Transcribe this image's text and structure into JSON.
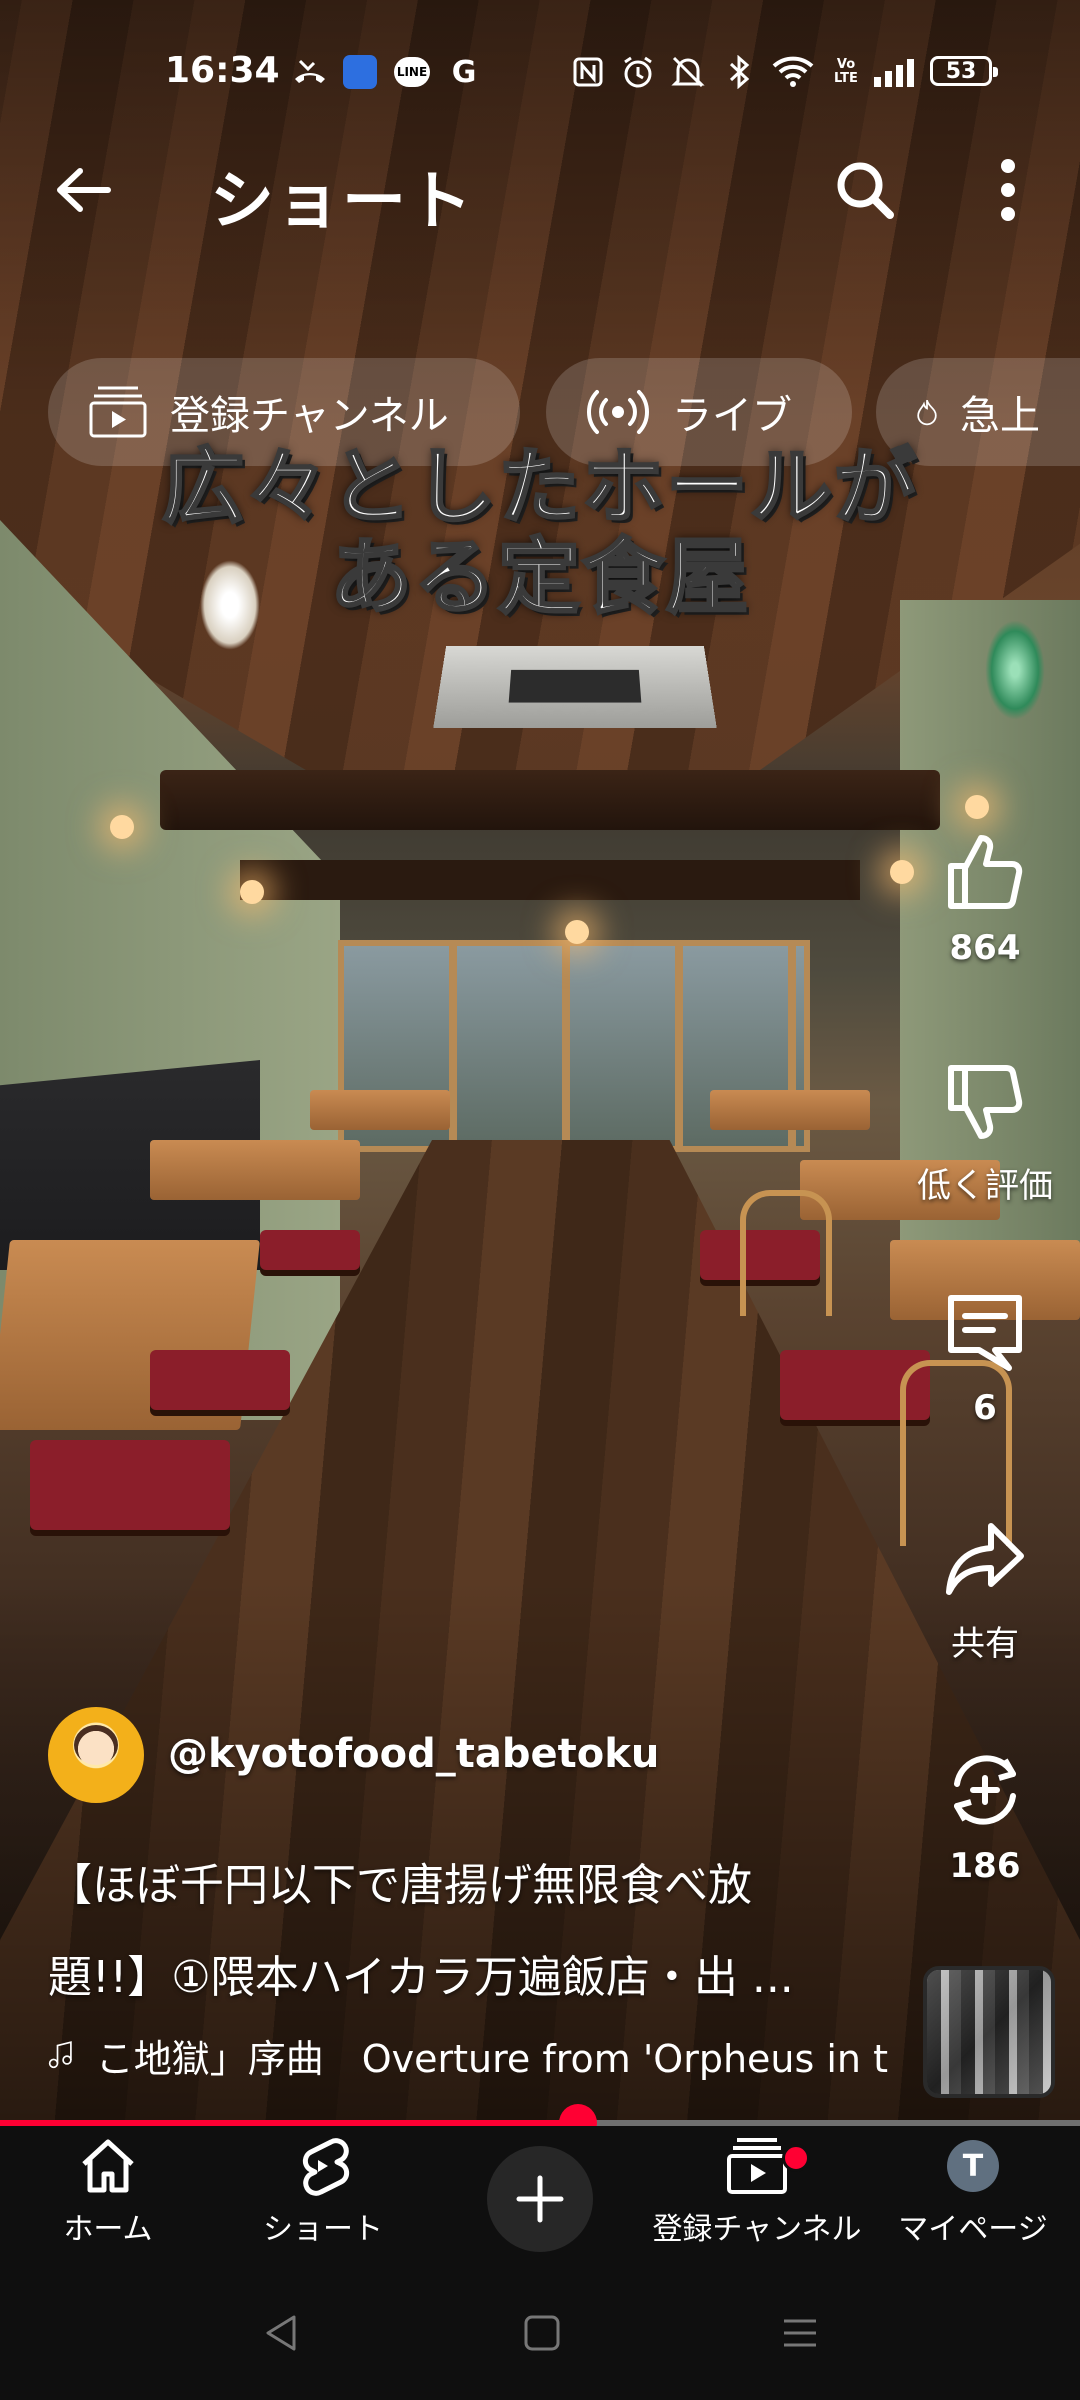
{
  "status_bar": {
    "time": "16:34",
    "battery": "53",
    "left_icons": [
      "missed-call-icon",
      "app-badge-icon",
      "line-icon",
      "google-icon"
    ],
    "right_icons": [
      "nfc-icon",
      "alarm-icon",
      "mute-icon",
      "bluetooth-icon",
      "wifi-icon",
      "volte-icon",
      "signal-icon",
      "battery-icon"
    ],
    "line_label": "LINE",
    "google_label": "G",
    "volte_label": "Vo LTE"
  },
  "header": {
    "title": "ショート",
    "back_icon": "back-arrow-icon",
    "search_icon": "search-icon",
    "more_icon": "more-vert-icon"
  },
  "chips": [
    {
      "label": "登録チャンネル",
      "icon": "subscriptions-icon"
    },
    {
      "label": "ライブ",
      "icon": "live-icon"
    },
    {
      "label": "急上",
      "icon": "trending-icon"
    }
  ],
  "caption": {
    "line1": "広々としたホールが",
    "line2": "ある定食屋"
  },
  "actions": {
    "like_count": "864",
    "dislike_label": "低く評価",
    "comment_count": "6",
    "share_label": "共有",
    "remix_count": "186"
  },
  "channel": {
    "handle": "@kyotofood_tabetoku"
  },
  "description": {
    "line1": "【ほぼ千円以下で唐揚げ無限食べ放",
    "line2": "題!!】①隈本ハイカラ万遍飯店・出 ..."
  },
  "music": {
    "text": "こ地獄」序曲　Overture from 'Orpheus in t"
  },
  "progress": {
    "fraction": 0.535
  },
  "nav": {
    "items": [
      {
        "label": "ホーム",
        "icon": "home-icon"
      },
      {
        "label": "ショート",
        "icon": "shorts-icon"
      },
      {
        "label": "",
        "icon": "create-plus-icon"
      },
      {
        "label": "登録チャンネル",
        "icon": "subscriptions-icon"
      },
      {
        "label": "マイページ",
        "icon": "avatar"
      }
    ],
    "avatar_letter": "T"
  },
  "colors": {
    "accent": "#ff0033",
    "nav_bg": "#0f0f0f",
    "chip_bg": "rgba(255,255,255,0.17)"
  }
}
